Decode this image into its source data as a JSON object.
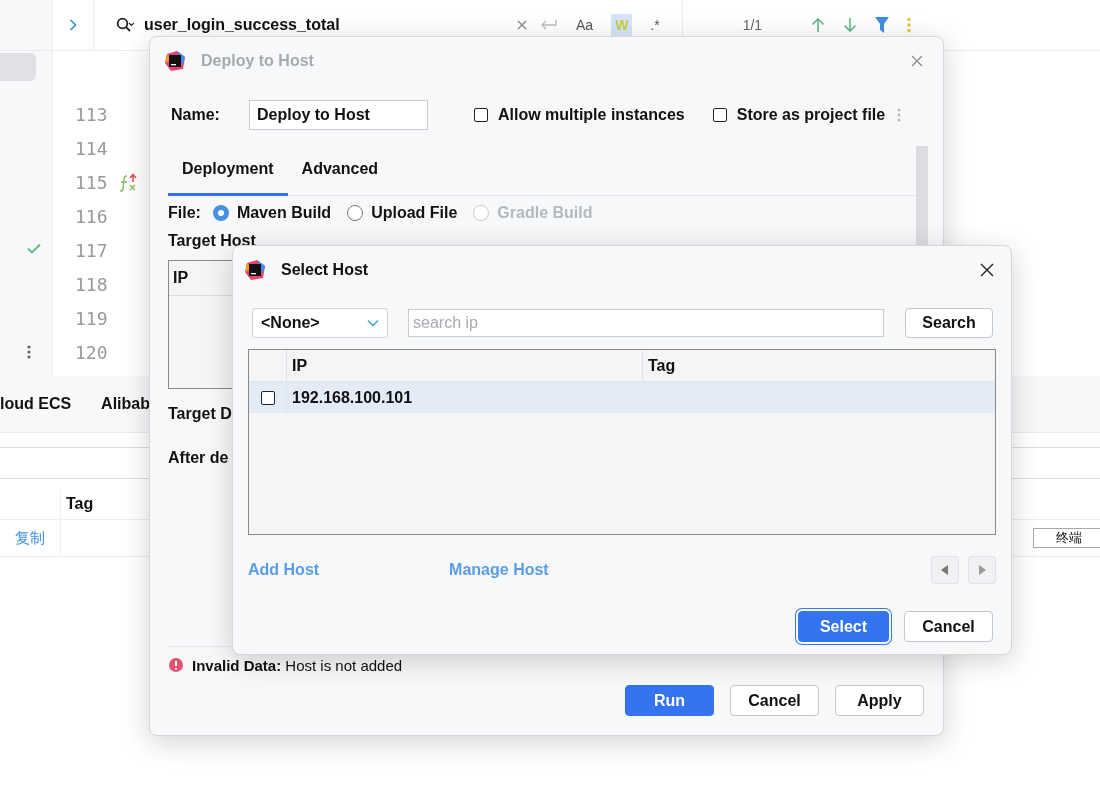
{
  "ide": {
    "find_bar": {
      "query": "user_login_success_total",
      "options": [
        {
          "label": "Aa",
          "selected": false
        },
        {
          "label": "W",
          "selected": true
        },
        {
          "label": ".*",
          "selected": false
        }
      ],
      "match_count": "1/1"
    },
    "line_numbers": [
      "113",
      "114",
      "115",
      "116",
      "117",
      "118",
      "119",
      "120"
    ],
    "bottom_panel": {
      "tabs": [
        {
          "label": "loud ECS"
        },
        {
          "label": "Alibab"
        }
      ],
      "table": {
        "columns": [
          "Tag"
        ],
        "rows": [
          {
            "action": "复制"
          }
        ]
      },
      "right_cell": "终端"
    }
  },
  "deploy_dialog": {
    "title": "Deploy to Host",
    "name_label": "Name:",
    "name_value": "Deploy to Host",
    "options": [
      {
        "label": "Allow multiple instances",
        "checked": false
      },
      {
        "label": "Store as project file",
        "checked": false
      }
    ],
    "tabs": [
      {
        "label": "Deployment",
        "selected": true
      },
      {
        "label": "Advanced",
        "selected": false
      }
    ],
    "file_label": "File:",
    "file_options": [
      {
        "label": "Maven Build",
        "selected": true,
        "disabled": false
      },
      {
        "label": "Upload File",
        "selected": false,
        "disabled": false
      },
      {
        "label": "Gradle Build",
        "selected": false,
        "disabled": true
      }
    ],
    "target_host_label": "Target Host",
    "target_host_columns": [
      "IP"
    ],
    "target_dir_label": "Target D",
    "after_label": "After de",
    "error": {
      "title": "Invalid Data:",
      "message": "Host is not added"
    },
    "buttons": [
      {
        "label": "Run",
        "kind": "primary"
      },
      {
        "label": "Cancel",
        "kind": "default"
      },
      {
        "label": "Apply",
        "kind": "default"
      }
    ]
  },
  "select_host_dialog": {
    "title": "Select Host",
    "group_select": "<None>",
    "search": {
      "placeholder": "search ip"
    },
    "search_button": "Search",
    "table": {
      "columns": [
        "IP",
        "Tag"
      ],
      "rows": [
        {
          "ip": "192.168.100.101",
          "checked": false,
          "selected": true
        }
      ]
    },
    "links": [
      "Add Host",
      "Manage Host"
    ],
    "buttons": [
      {
        "label": "Select",
        "kind": "primary"
      },
      {
        "label": "Cancel",
        "kind": "default"
      }
    ]
  }
}
